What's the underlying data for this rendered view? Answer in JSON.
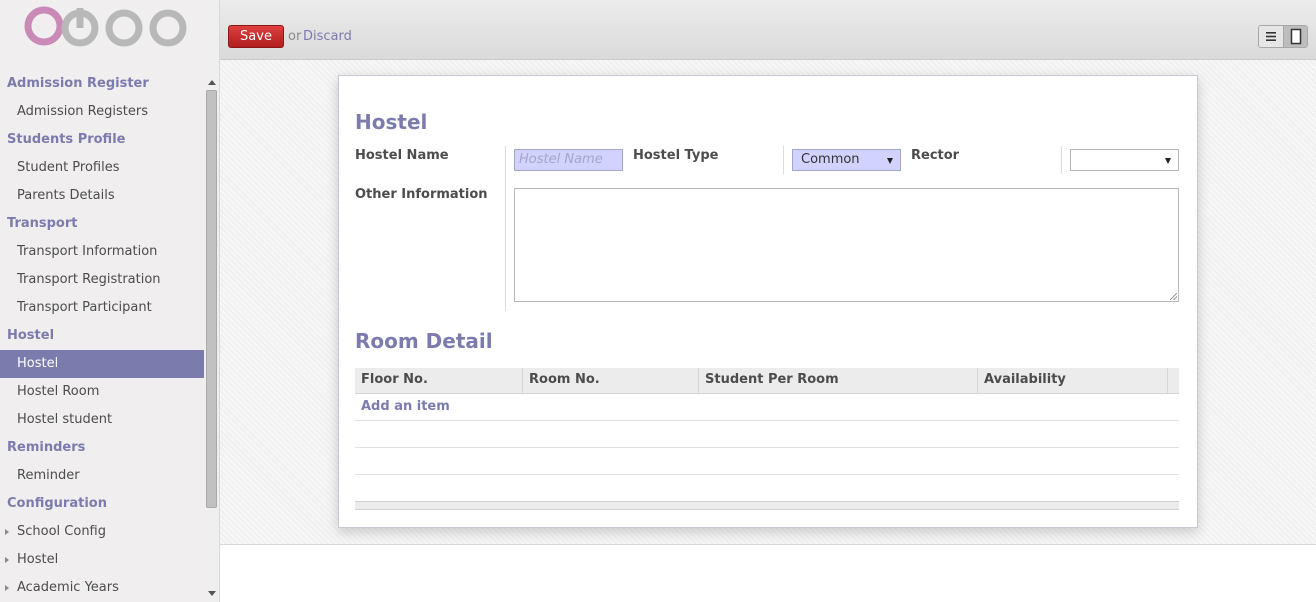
{
  "sidebar": {
    "logo_text": "odoo",
    "sections": [
      {
        "title": "Admission Register",
        "items": [
          {
            "label": "Admission Registers"
          }
        ]
      },
      {
        "title": "Students Profile",
        "items": [
          {
            "label": "Student Profiles"
          },
          {
            "label": "Parents Details"
          }
        ]
      },
      {
        "title": "Transport",
        "items": [
          {
            "label": "Transport Information"
          },
          {
            "label": "Transport Registration"
          },
          {
            "label": "Transport Participant"
          }
        ]
      },
      {
        "title": "Hostel",
        "items": [
          {
            "label": "Hostel"
          },
          {
            "label": "Hostel Room"
          },
          {
            "label": "Hostel student"
          }
        ]
      },
      {
        "title": "Reminders",
        "items": [
          {
            "label": "Reminder"
          }
        ]
      },
      {
        "title": "Configuration",
        "items": [
          {
            "label": "School Config"
          },
          {
            "label": "Hostel"
          },
          {
            "label": "Academic Years"
          }
        ]
      }
    ],
    "active_item": "Hostel"
  },
  "toolbar": {
    "save_label": "Save",
    "or_label": "or",
    "discard_label": "Discard"
  },
  "form": {
    "section_title": "Hostel",
    "hostel_name_label": "Hostel Name",
    "hostel_name_placeholder": "Hostel Name",
    "hostel_name_value": "",
    "hostel_type_label": "Hostel Type",
    "hostel_type_value": "Common",
    "rector_label": "Rector",
    "rector_value": "",
    "other_info_label": "Other Information",
    "other_info_value": ""
  },
  "room_detail": {
    "title": "Room Detail",
    "columns": [
      "Floor No.",
      "Room No.",
      "Student Per Room",
      "Availability"
    ],
    "add_item_label": "Add an item",
    "rows": []
  },
  "colors": {
    "accent": "#7c7bad",
    "save_button": "#c32828",
    "required_field_bg": "#d2d2ff"
  }
}
